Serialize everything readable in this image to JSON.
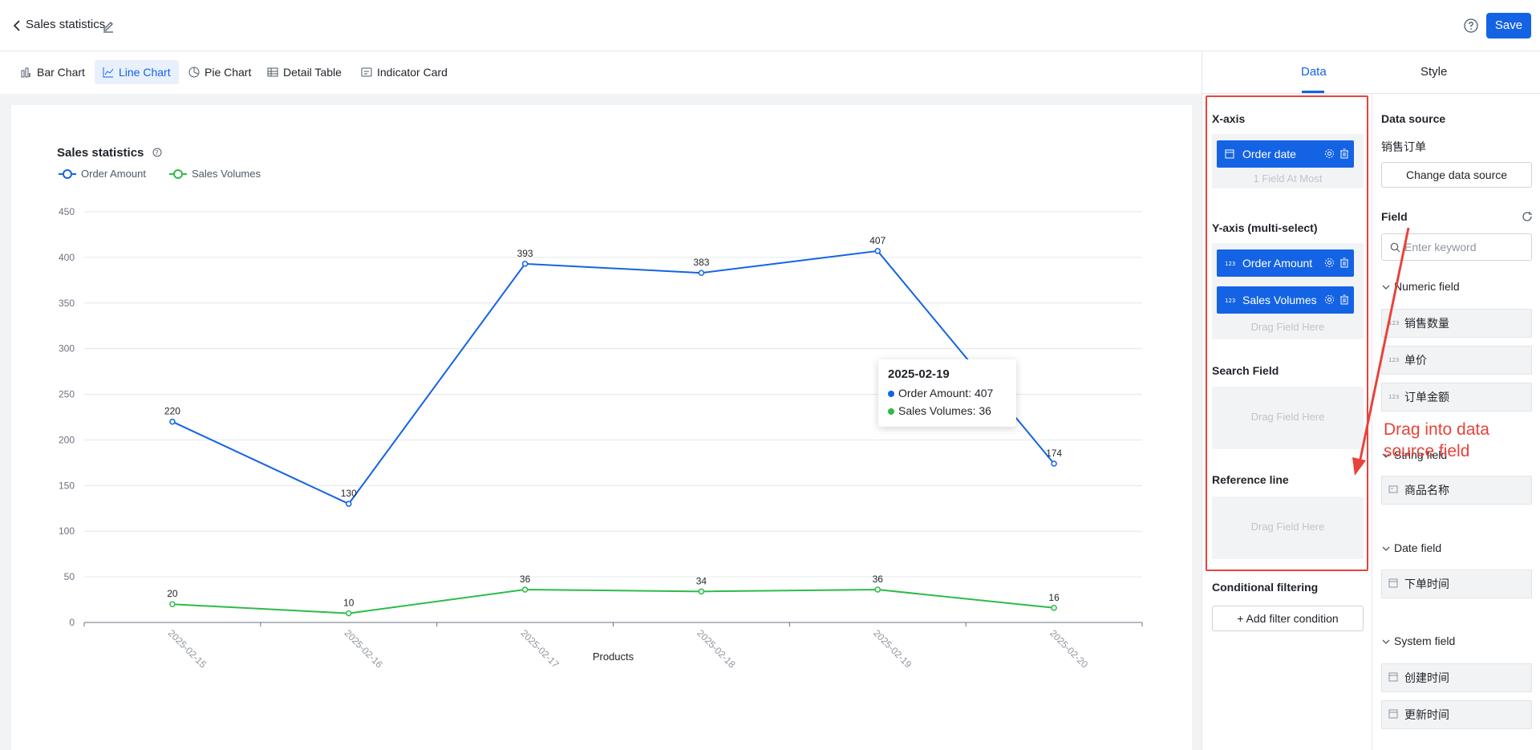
{
  "header": {
    "title": "Sales statistics",
    "save_label": "Save"
  },
  "chart_tabs": [
    {
      "label": "Bar Chart",
      "icon": "bar-chart-icon"
    },
    {
      "label": "Line Chart",
      "icon": "line-chart-icon",
      "active": true
    },
    {
      "label": "Pie Chart",
      "icon": "pie-chart-icon"
    },
    {
      "label": "Detail Table",
      "icon": "table-icon"
    },
    {
      "label": "Indicator Card",
      "icon": "card-icon"
    }
  ],
  "panel_tabs": {
    "data": "Data",
    "style": "Style"
  },
  "config": {
    "x_axis_label": "X-axis",
    "x_axis_field": "Order date",
    "x_axis_hint": "1 Field At Most",
    "y_axis_label": "Y-axis (multi-select)",
    "y_axis_fields": [
      "Order Amount",
      "Sales Volumes"
    ],
    "y_axis_hint": "Drag Field Here",
    "search_label": "Search Field",
    "search_hint": "Drag Field Here",
    "reference_label": "Reference line",
    "reference_hint": "Drag Field Here",
    "filter_label": "Conditional filtering",
    "add_filter": "+ Add filter condition"
  },
  "datasource": {
    "label": "Data source",
    "name": "销售订单",
    "change_label": "Change data source",
    "field_label": "Field",
    "search_placeholder": "Enter keyword",
    "groups": {
      "numeric": "Numeric field",
      "string": "String field",
      "date": "Date field",
      "system": "System field"
    },
    "numeric_fields": [
      "销售数量",
      "单价",
      "订单金额"
    ],
    "string_fields": [
      "商品名称"
    ],
    "date_fields": [
      "下单时间"
    ],
    "system_fields": [
      "创建时间",
      "更新时间"
    ]
  },
  "annotation": "Drag into data source field",
  "tooltip": {
    "date": "2025-02-19",
    "rows": [
      {
        "name": "Order Amount",
        "value": "407",
        "color": "#1463e5"
      },
      {
        "name": "Sales Volumes",
        "value": "36",
        "color": "#2dbb4a"
      }
    ]
  },
  "chart_data": {
    "type": "line",
    "title": "Sales statistics",
    "xlabel": "Products",
    "ylabel": "",
    "categories": [
      "2025-02-15",
      "2025-02-16",
      "2025-02-17",
      "2025-02-18",
      "2025-02-19",
      "2025-02-20"
    ],
    "series": [
      {
        "name": "Order Amount",
        "values": [
          220,
          130,
          393,
          383,
          407,
          174
        ],
        "color": "#1463e5"
      },
      {
        "name": "Sales Volumes",
        "values": [
          20,
          10,
          36,
          34,
          36,
          16
        ],
        "color": "#2dbb4a"
      }
    ],
    "ylim": [
      0,
      450
    ],
    "yticks": [
      0,
      50,
      100,
      150,
      200,
      250,
      300,
      350,
      400,
      450
    ],
    "grid": true,
    "legend": "top-left"
  },
  "colors": {
    "accent": "#1463e5",
    "annotation": "#e8433a"
  }
}
